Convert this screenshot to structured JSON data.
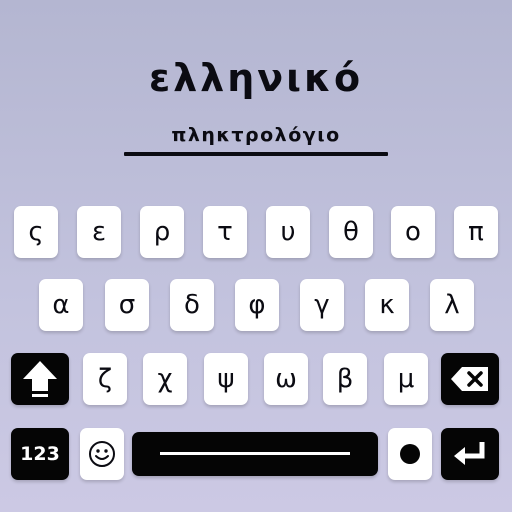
{
  "header": {
    "title": "ελληνικό",
    "subtitle": "πληκτρολόγιο"
  },
  "keyboard": {
    "row1": [
      "ς",
      "ε",
      "ρ",
      "τ",
      "υ",
      "θ",
      "ο",
      "π"
    ],
    "row2": [
      "α",
      "σ",
      "δ",
      "φ",
      "γ",
      "κ",
      "λ"
    ],
    "row3": [
      "ζ",
      "χ",
      "ψ",
      "ω",
      "β",
      "μ"
    ],
    "numbers_key_label": "123",
    "icons": {
      "shift": "shift-arrow-icon",
      "backspace": "backspace-icon",
      "emoji": "smiley-icon",
      "space": "space-bar",
      "dot": "dot-icon",
      "enter": "enter-return-icon"
    }
  },
  "colors": {
    "background_top": "#b4b6d1",
    "background_bottom": "#ccc9e4",
    "key_light": "#ffffff",
    "key_dark": "#050505",
    "text": "#0b0b12"
  }
}
